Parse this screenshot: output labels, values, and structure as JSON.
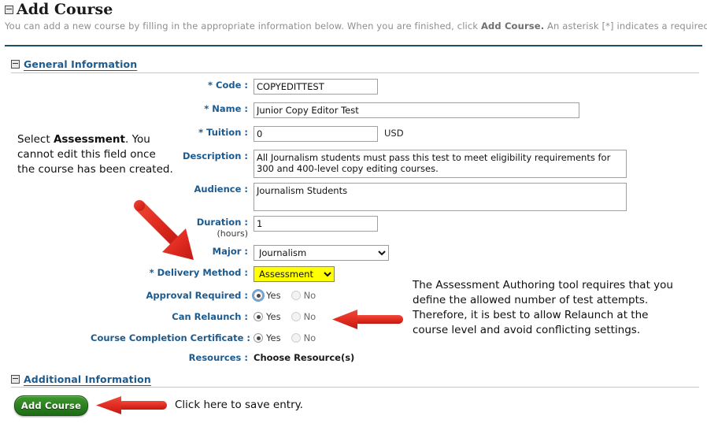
{
  "header": {
    "title": "Add Course",
    "collapse_icon": "collapse-minus-box-icon",
    "intro_before": "You can add a new course by filling in the appropriate information below. When you are finished, click ",
    "intro_bold": "Add Course.",
    "intro_after": " An asterisk [*] indicates a required field."
  },
  "sections": {
    "general": {
      "label": "General Information",
      "icon": "collapse-minus-box-icon"
    },
    "additional": {
      "label": "Additional Information",
      "icon": "collapse-minus-box-icon"
    }
  },
  "form": {
    "code": {
      "label": "Code :",
      "required": "*",
      "value": "COPYEDITTEST"
    },
    "name": {
      "label": "Name :",
      "required": "*",
      "value": "Junior Copy Editor Test"
    },
    "tuition": {
      "label": "Tuition :",
      "required": "*",
      "value": "0",
      "unit": "USD"
    },
    "description": {
      "label": "Description :",
      "value": "All Journalism students must pass this test to meet eligibility requirements for 300 and 400-level copy editing courses."
    },
    "audience": {
      "label": "Audience :",
      "value": "Journalism Students"
    },
    "duration": {
      "label": "Duration :",
      "sub_label": "(hours)",
      "value": "1"
    },
    "major": {
      "label": "Major :",
      "value": "Journalism",
      "options": [
        "Journalism"
      ]
    },
    "delivery_method": {
      "label": "Delivery Method :",
      "required": "*",
      "value": "Assessment",
      "options": [
        "Assessment"
      ],
      "highlight_color": "#ffff00"
    },
    "approval_required": {
      "label": "Approval Required :",
      "yes_label": "Yes",
      "no_label": "No",
      "selected": "Yes"
    },
    "can_relaunch": {
      "label": "Can Relaunch :",
      "yes_label": "Yes",
      "no_label": "No",
      "selected": "Yes"
    },
    "completion_certificate": {
      "label": "Course Completion Certificate :",
      "yes_label": "Yes",
      "no_label": "No",
      "selected": "Yes"
    },
    "resources": {
      "label": "Resources :",
      "value": "Choose Resource(s)"
    }
  },
  "buttons": {
    "add_course": "Add Course"
  },
  "annotations": {
    "left_note_line1_pre": "Select ",
    "left_note_line1_bold": "Assessment",
    "left_note_line1_post": ".",
    "left_note_rest": "You cannot edit this field once the course has been created.",
    "right_note": "The Assessment Authoring tool requires that you define the allowed number of test attempts. Therefore, it is best to allow Relaunch at the course level and avoid conflicting settings.",
    "bottom_note": "Click here to save entry.",
    "arrow_color": "#e02b20"
  }
}
